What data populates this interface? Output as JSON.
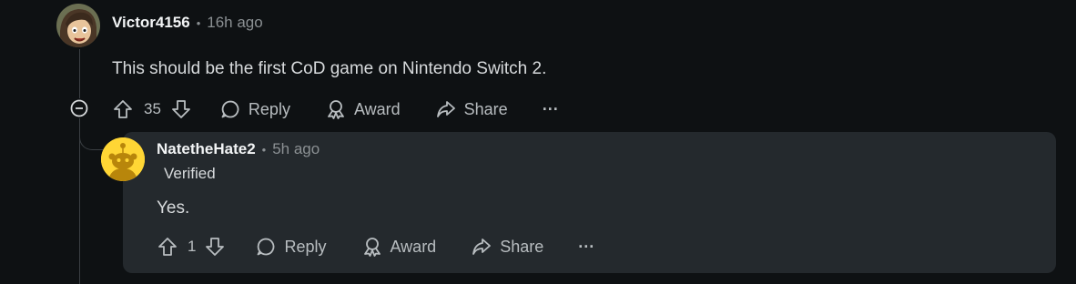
{
  "comment": {
    "author": "Victor4156",
    "separator": "•",
    "time": "16h ago",
    "body": "This should be the first CoD game on Nintendo Switch 2.",
    "actions": {
      "votes": "35",
      "reply": "Reply",
      "award": "Award",
      "share": "Share",
      "more": "···"
    }
  },
  "reply": {
    "author": "NatetheHate2",
    "separator": "•",
    "time": "5h ago",
    "flair": "Verified",
    "body": "Yes.",
    "actions": {
      "votes": "1",
      "reply": "Reply",
      "award": "Award",
      "share": "Share",
      "more": "···"
    }
  },
  "colors": {
    "background": "#0e1113",
    "reply_panel": "#24292d",
    "snoo_avatar": "#ffd635"
  }
}
